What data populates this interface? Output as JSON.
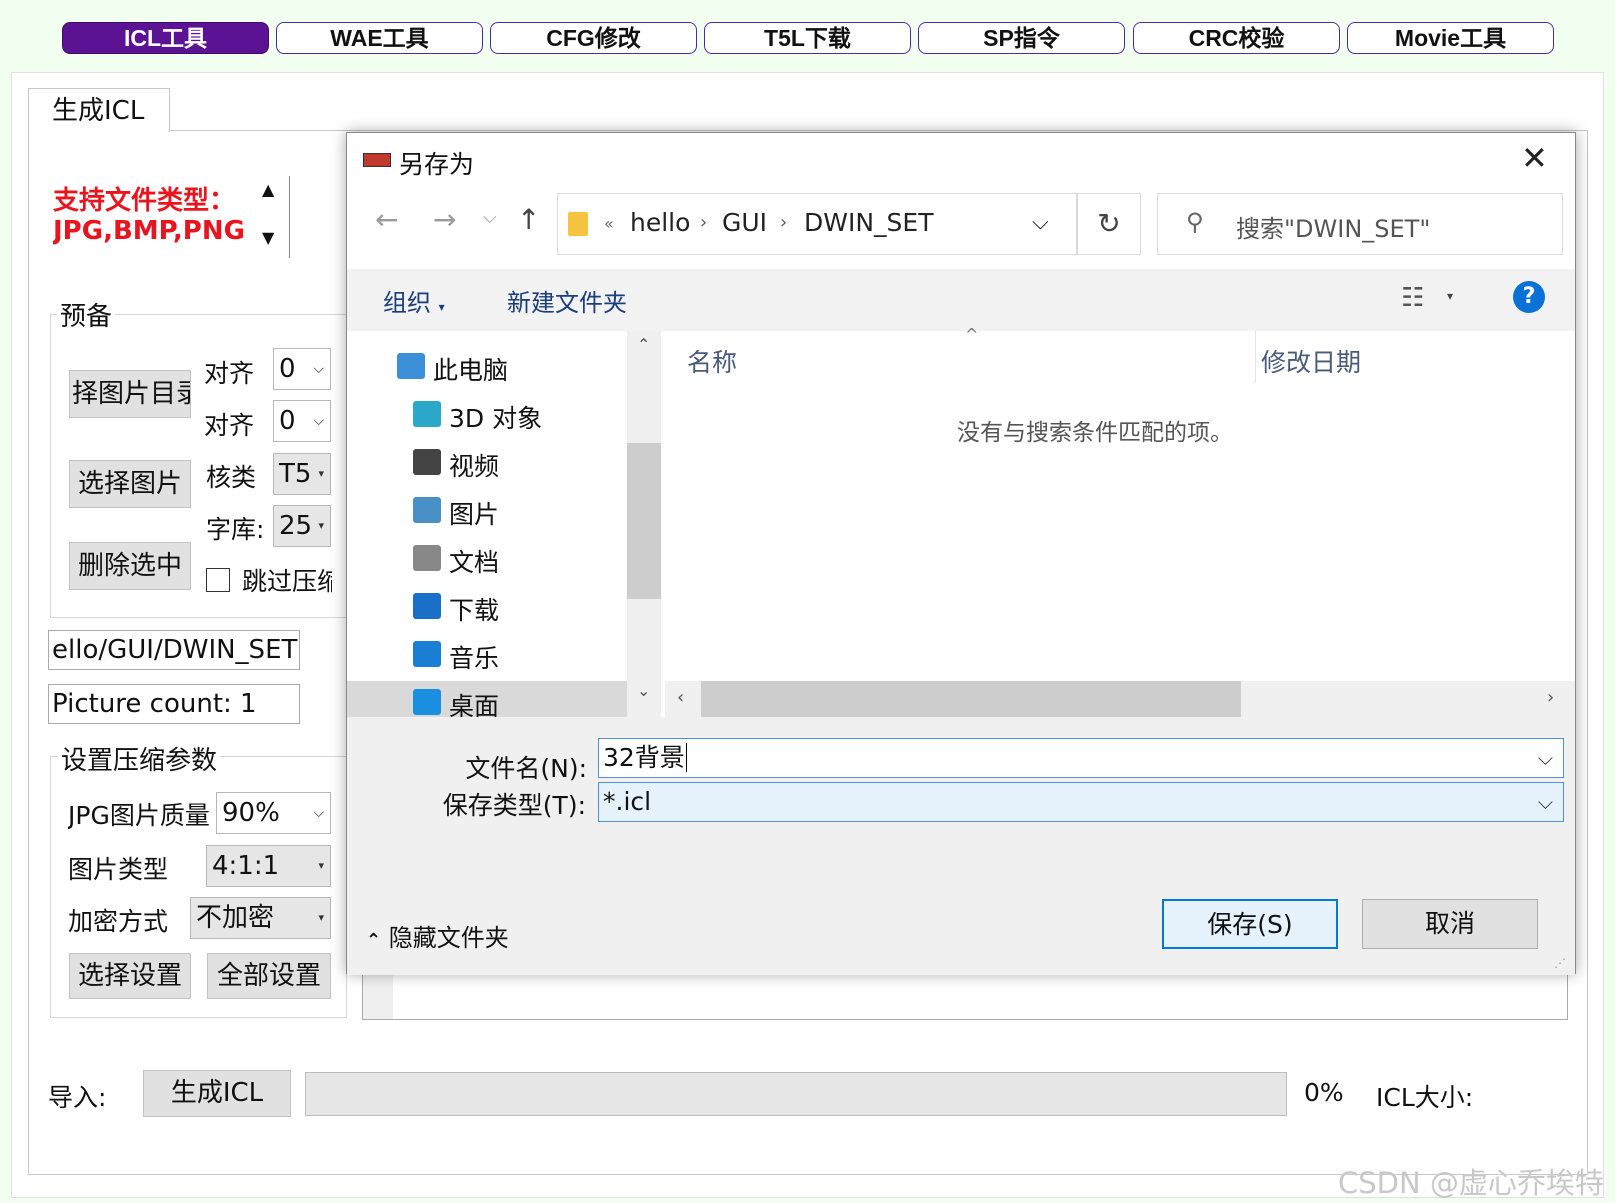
{
  "top_tabs": [
    {
      "label": "ICL工具",
      "active": true
    },
    {
      "label": "WAE工具",
      "active": false
    },
    {
      "label": "CFG修改",
      "active": false
    },
    {
      "label": "T5L下载",
      "active": false
    },
    {
      "label": "SP指令",
      "active": false
    },
    {
      "label": "CRC校验",
      "active": false
    },
    {
      "label": "Movie工具",
      "active": false
    }
  ],
  "main": {
    "tab_label": "生成ICL",
    "support_line1": "支持文件类型：",
    "support_line2": "JPG,BMP,PNG",
    "prep_group": "预备",
    "select_dir_button": "择图片目录",
    "select_image_button": "选择图片",
    "delete_selected_button": "删除选中",
    "align1_label": "对齐",
    "align1_value": "0",
    "align2_label": "对齐",
    "align2_value": "0",
    "core_label": "核类",
    "core_value": "T5",
    "font_label": "字库:",
    "font_value": "25",
    "skip_label": "跳过压缩",
    "path_value": "ello/GUI/DWIN_SET",
    "picture_count": "Picture count: 1",
    "compress_group": "设置压缩参数",
    "jpg_quality_label": "JPG图片质量",
    "jpg_quality_value": "90%",
    "pic_type_label": "图片类型",
    "pic_type_value": "4:1:1",
    "encrypt_label": "加密方式",
    "encrypt_value": "不加密",
    "select_settings_button": "选择设置",
    "all_settings_button": "全部设置",
    "import_label": "导入:",
    "generate_button": "生成ICL",
    "progress_percent": "0%",
    "progress_value": 0,
    "icl_size_label": "ICL大小:"
  },
  "dialog": {
    "title": "另存为",
    "address": {
      "prefix": "«",
      "crumbs": [
        "hello",
        "GUI",
        "DWIN_SET"
      ]
    },
    "search_placeholder": "搜索\"DWIN_SET\"",
    "organize": "组织",
    "new_folder": "新建文件夹",
    "nav_items": [
      {
        "label": "此电脑",
        "icon": "computer-icon"
      },
      {
        "label": "3D 对象",
        "icon": "cube-3d-icon"
      },
      {
        "label": "视频",
        "icon": "video-icon"
      },
      {
        "label": "图片",
        "icon": "picture-icon"
      },
      {
        "label": "文档",
        "icon": "document-icon"
      },
      {
        "label": "下载",
        "icon": "download-icon"
      },
      {
        "label": "音乐",
        "icon": "music-icon"
      },
      {
        "label": "桌面",
        "icon": "desktop-icon"
      }
    ],
    "col_name": "名称",
    "col_date": "修改日期",
    "empty_message": "没有与搜索条件匹配的项。",
    "filename_label": "文件名(N):",
    "filename_value": "32背景",
    "filetype_label": "保存类型(T):",
    "filetype_value": "*.icl",
    "hide_folders": "隐藏文件夹",
    "save_button": "保存(S)",
    "cancel_button": "取消"
  },
  "watermark": "CSDN @虚心乔埃特",
  "colors": {
    "active_tab": "#5b1393",
    "accent_blue": "#0078d7",
    "red_text": "#e8141e"
  }
}
